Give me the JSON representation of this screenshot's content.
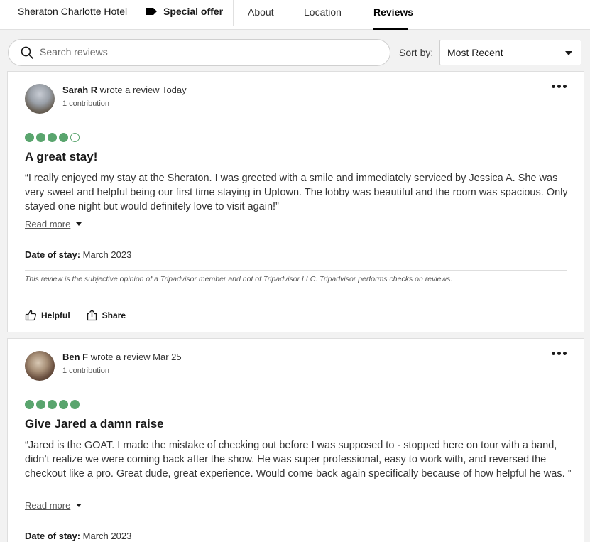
{
  "nav": {
    "hotel_name": "Sheraton Charlotte Hotel",
    "special_offer": "Special offer",
    "tabs": [
      "About",
      "Location",
      "Reviews"
    ],
    "active_tab": "Reviews"
  },
  "search": {
    "placeholder": "Search reviews",
    "value": ""
  },
  "sort": {
    "label": "Sort by:",
    "selected": "Most Recent"
  },
  "reviews": [
    {
      "name": "Sarah R",
      "wrote": "wrote a review Today",
      "contributions": "1 contribution",
      "rating": 4,
      "rating_max": 5,
      "title": "A great stay!",
      "body": "“I really enjoyed my stay at the Sheraton. I was greeted with a smile and immediately serviced by Jessica A. She was very sweet and helpful being our first time staying in Uptown. The lobby was beautiful and the room was spacious. Only stayed one night but would definitely love to visit again!”",
      "read_more": "Read more",
      "date_label": "Date of stay:",
      "date_value": "March 2023",
      "disclaimer": "This review is the subjective opinion of a Tripadvisor member and not of Tripadvisor LLC. Tripadvisor performs checks on reviews.",
      "helpful": "Helpful",
      "share": "Share"
    },
    {
      "name": "Ben F",
      "wrote": "wrote a review Mar 25",
      "contributions": "1 contribution",
      "rating": 5,
      "rating_max": 5,
      "title": "Give Jared a damn raise",
      "body": "“Jared is the GOAT. I made the mistake of checking out before I was supposed to - stopped here on tour with a band, didn’t realize we were coming back after the show. He was super professional, easy to work with, and reversed the checkout like a pro. Great dude, great experience. Would come back again specifically because of how helpful he was. ”",
      "read_more": "Read more",
      "date_label": "Date of stay:",
      "date_value": "March 2023"
    }
  ],
  "colors": {
    "bubble_green": "#5aa56e",
    "background": "#f2f2f2"
  }
}
